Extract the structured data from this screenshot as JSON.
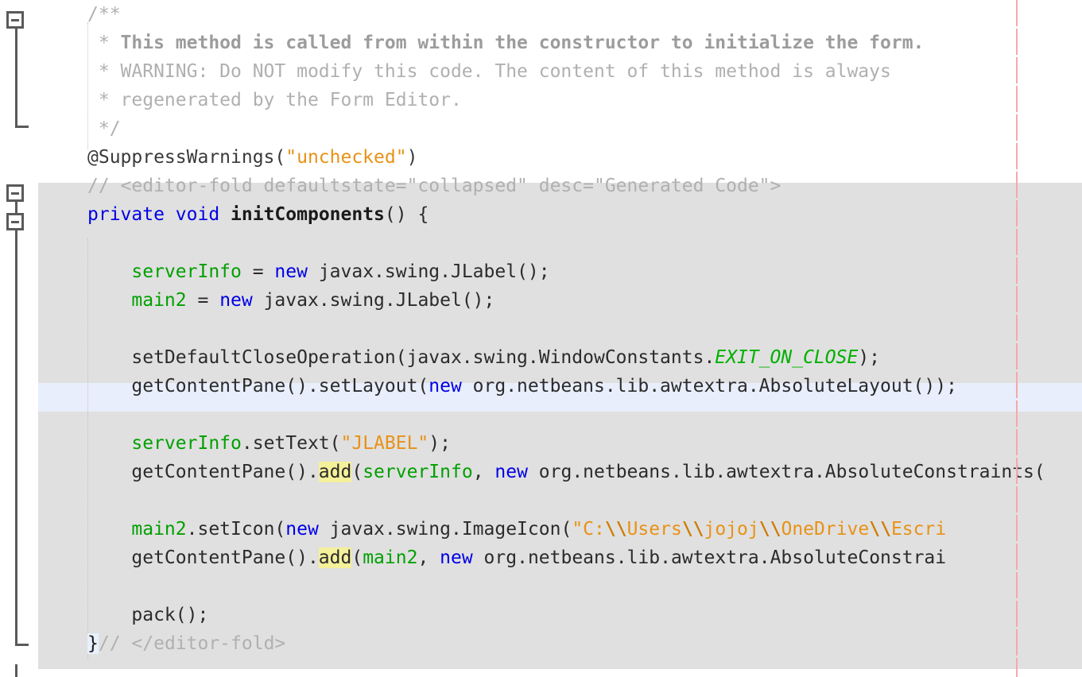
{
  "editor": {
    "kind": "java-source-editor",
    "theme": {
      "background": "#ffffff",
      "block_shade": "#e0e0e0",
      "caret_line": "#e8eefb",
      "margin_guide": "#f7a8a8",
      "occurrence_highlight": "#f5f09a",
      "comment": "#b0b0b0",
      "keyword": "#0000e6",
      "field": "#00a000",
      "string": "#e89217",
      "static_field": "#00b000",
      "gutter_fold": "#5a5a5a"
    },
    "gutter": {
      "folds": [
        {
          "name": "javadoc-fold",
          "state": "expanded",
          "glyph": "minus"
        },
        {
          "name": "editor-fold-region",
          "state": "expanded",
          "glyph": "minus"
        },
        {
          "name": "method-body-fold",
          "state": "expanded",
          "glyph": "minus"
        }
      ]
    },
    "lines": [
      {
        "n": 1,
        "indent": 0,
        "text": "/**",
        "tokens": [
          {
            "t": "/**",
            "c": "t-cmt"
          }
        ]
      },
      {
        "n": 2,
        "indent": 0,
        "text": " * This method is called from within the constructor to initialize the form.",
        "tokens": [
          {
            "t": " * ",
            "c": "t-cmt"
          },
          {
            "t": "This method is called from within the constructor to initialize the form.",
            "c": "t-cmt-b"
          }
        ]
      },
      {
        "n": 3,
        "indent": 0,
        "text": " * WARNING: Do NOT modify this code. The content of this method is always",
        "tokens": [
          {
            "t": " * WARNING: Do NOT modify this code. The content of this method is always",
            "c": "t-cmt"
          }
        ]
      },
      {
        "n": 4,
        "indent": 0,
        "text": " * regenerated by the Form Editor.",
        "tokens": [
          {
            "t": " * regenerated by the Form Editor.",
            "c": "t-cmt"
          }
        ]
      },
      {
        "n": 5,
        "indent": 0,
        "text": " */",
        "tokens": [
          {
            "t": " */",
            "c": "t-cmt"
          }
        ]
      },
      {
        "n": 6,
        "indent": 0,
        "text": "@SuppressWarnings(\"unchecked\")",
        "tokens": [
          {
            "t": "@SuppressWarnings(",
            "c": "t-anno"
          },
          {
            "t": "\"unchecked\"",
            "c": "t-str"
          },
          {
            "t": ")",
            "c": "t-anno"
          }
        ]
      },
      {
        "n": 7,
        "indent": 0,
        "text": "// <editor-fold defaultstate=\"collapsed\" desc=\"Generated Code\">",
        "tokens": [
          {
            "t": "// <editor-fold defaultstate=\"collapsed\" desc=\"Generated Code\">",
            "c": "t-cmt"
          }
        ]
      },
      {
        "n": 8,
        "indent": 0,
        "text": "private void initComponents() {",
        "tokens": [
          {
            "t": "private",
            "c": "t-kw"
          },
          {
            "t": " ",
            "c": "t-ident"
          },
          {
            "t": "void",
            "c": "t-kw"
          },
          {
            "t": " ",
            "c": "t-ident"
          },
          {
            "t": "initComponents",
            "c": "t-method"
          },
          {
            "t": "() {",
            "c": "t-ident"
          }
        ]
      },
      {
        "n": 9,
        "indent": 0,
        "text": "",
        "tokens": []
      },
      {
        "n": 10,
        "indent": 1,
        "text": "    serverInfo = new javax.swing.JLabel();",
        "tokens": [
          {
            "t": "    ",
            "c": "t-ident"
          },
          {
            "t": "serverInfo",
            "c": "t-field"
          },
          {
            "t": " = ",
            "c": "t-ident"
          },
          {
            "t": "new",
            "c": "t-kw"
          },
          {
            "t": " javax.swing.JLabel();",
            "c": "t-ident"
          }
        ]
      },
      {
        "n": 11,
        "indent": 1,
        "text": "    main2 = new javax.swing.JLabel();",
        "tokens": [
          {
            "t": "    ",
            "c": "t-ident"
          },
          {
            "t": "main2",
            "c": "t-field"
          },
          {
            "t": " = ",
            "c": "t-ident"
          },
          {
            "t": "new",
            "c": "t-kw"
          },
          {
            "t": " javax.swing.JLabel();",
            "c": "t-ident"
          }
        ]
      },
      {
        "n": 12,
        "indent": 1,
        "text": "",
        "tokens": []
      },
      {
        "n": 13,
        "indent": 1,
        "text": "    setDefaultCloseOperation(javax.swing.WindowConstants.EXIT_ON_CLOSE);",
        "tokens": [
          {
            "t": "    setDefaultCloseOperation(javax.swing.WindowConstants.",
            "c": "t-ident"
          },
          {
            "t": "EXIT_ON_CLOSE",
            "c": "t-static"
          },
          {
            "t": ");",
            "c": "t-ident"
          }
        ]
      },
      {
        "n": 14,
        "indent": 1,
        "caret": true,
        "text": "    getContentPane().setLayout(new org.netbeans.lib.awtextra.AbsoluteLayout());",
        "tokens": [
          {
            "t": "    getContentPane().setLayout(",
            "c": "t-ident"
          },
          {
            "t": "new",
            "c": "t-kw"
          },
          {
            "t": " org.netbeans.lib.awtextra.AbsoluteLayout());",
            "c": "t-ident"
          }
        ]
      },
      {
        "n": 15,
        "indent": 1,
        "text": "",
        "tokens": []
      },
      {
        "n": 16,
        "indent": 1,
        "text": "    serverInfo.setText(\"JLABEL\");",
        "tokens": [
          {
            "t": "    ",
            "c": "t-ident"
          },
          {
            "t": "serverInfo",
            "c": "t-field"
          },
          {
            "t": ".setText(",
            "c": "t-ident"
          },
          {
            "t": "\"JLABEL\"",
            "c": "t-str"
          },
          {
            "t": ");",
            "c": "t-ident"
          }
        ]
      },
      {
        "n": 17,
        "indent": 1,
        "text": "    getContentPane().add(serverInfo, new org.netbeans.lib.awtextra.AbsoluteConstraints(",
        "tokens": [
          {
            "t": "    getContentPane().",
            "c": "t-ident"
          },
          {
            "t": "add",
            "c": "t-ident hl-occ"
          },
          {
            "t": "(",
            "c": "t-ident"
          },
          {
            "t": "serverInfo",
            "c": "t-field"
          },
          {
            "t": ", ",
            "c": "t-ident"
          },
          {
            "t": "new",
            "c": "t-kw"
          },
          {
            "t": " org.netbeans.lib.awtextra.AbsoluteConstraints(",
            "c": "t-ident"
          }
        ]
      },
      {
        "n": 18,
        "indent": 1,
        "text": "",
        "tokens": []
      },
      {
        "n": 19,
        "indent": 1,
        "text": "    main2.setIcon(new javax.swing.ImageIcon(\"C:\\\\Users\\\\jojoj\\\\OneDrive\\\\Escri",
        "tokens": [
          {
            "t": "    ",
            "c": "t-ident"
          },
          {
            "t": "main2",
            "c": "t-field"
          },
          {
            "t": ".setIcon(",
            "c": "t-ident"
          },
          {
            "t": "new",
            "c": "t-kw"
          },
          {
            "t": " javax.swing.ImageIcon(",
            "c": "t-ident"
          },
          {
            "t": "\"C:",
            "c": "t-str"
          },
          {
            "t": "\\\\",
            "c": "t-esc"
          },
          {
            "t": "Users",
            "c": "t-str"
          },
          {
            "t": "\\\\",
            "c": "t-esc"
          },
          {
            "t": "jojoj",
            "c": "t-str"
          },
          {
            "t": "\\\\",
            "c": "t-esc"
          },
          {
            "t": "OneDrive",
            "c": "t-str"
          },
          {
            "t": "\\\\",
            "c": "t-esc"
          },
          {
            "t": "Escri",
            "c": "t-str"
          }
        ]
      },
      {
        "n": 20,
        "indent": 1,
        "text": "    getContentPane().add(main2, new org.netbeans.lib.awtextra.AbsoluteConstrai",
        "tokens": [
          {
            "t": "    getContentPane().",
            "c": "t-ident"
          },
          {
            "t": "add",
            "c": "t-ident hl-occ"
          },
          {
            "t": "(",
            "c": "t-ident"
          },
          {
            "t": "main2",
            "c": "t-field"
          },
          {
            "t": ", ",
            "c": "t-ident"
          },
          {
            "t": "new",
            "c": "t-kw"
          },
          {
            "t": " org.netbeans.lib.awtextra.AbsoluteConstrai",
            "c": "t-ident"
          }
        ]
      },
      {
        "n": 21,
        "indent": 1,
        "text": "",
        "tokens": []
      },
      {
        "n": 22,
        "indent": 1,
        "text": "    pack();",
        "tokens": [
          {
            "t": "    pack();",
            "c": "t-ident"
          }
        ]
      },
      {
        "n": 23,
        "indent": 0,
        "text": "}// </editor-fold>",
        "tokens": [
          {
            "t": "}",
            "c": "t-brace-m"
          },
          {
            "t": "// </editor-fold>",
            "c": "t-cmt"
          }
        ]
      }
    ]
  }
}
